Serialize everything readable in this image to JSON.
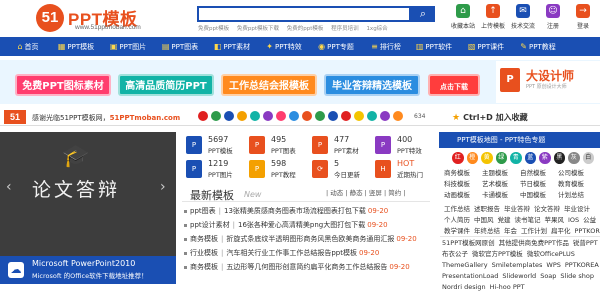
{
  "header": {
    "logo_badge": "51",
    "logo_title": "PPT模板",
    "logo_url": "www.51pptmoban.com",
    "search_placeholder": "",
    "hot_words": [
      "免费ppt模板",
      "免费ppt模板下载",
      "免费的ppt模板",
      "程序员培训",
      "1xg综合"
    ],
    "tools": [
      {
        "label": "收藏本站",
        "icon": "home-icon",
        "color": "#2e9b4a"
      },
      {
        "label": "上传模板",
        "icon": "upload-icon",
        "color": "#e8501e"
      },
      {
        "label": "技术交流",
        "icon": "chat-icon",
        "color": "#1a4fb3"
      },
      {
        "label": "注册",
        "icon": "user-icon",
        "color": "#8a3ac2"
      },
      {
        "label": "登录",
        "icon": "login-icon",
        "color": "#e8501e"
      }
    ]
  },
  "nav": [
    "首页",
    "PPT模板",
    "PPT图片",
    "PPT图表",
    "PPT素材",
    "PPT特效",
    "PPT专题",
    "排行榜",
    "PPT软件",
    "PPT课件",
    "PPT教程"
  ],
  "banner": {
    "pills": [
      {
        "label": "免费PPT图标素材",
        "color": "#ff3d6e"
      },
      {
        "label": "高清品质简历PPT",
        "color": "#12b3a6"
      },
      {
        "label": "工作总结会报模板",
        "color": "#ff8a1e"
      },
      {
        "label": "毕业答辩精选模板",
        "color": "#2b8de0"
      }
    ],
    "click_label": "点击下载",
    "ad_title": "大设计师",
    "ad_sub": "PPT 原创设计大师"
  },
  "welcome": {
    "badge": "51",
    "text_prefix": "感谢光临51PPT模板网，",
    "site": "51PPTmoban.com",
    "share_count": "634",
    "ctrl_d": "Ctrl+D 加入收藏"
  },
  "hero": {
    "caption": "论文答辩",
    "footer_line1": "Microsoft PowerPoint2010",
    "footer_line2": "Microsoft 的Office软件下载地址推荐！",
    "below": "PPT教程"
  },
  "stats": [
    {
      "num": "5697",
      "label": "PPT模板",
      "icon": "P",
      "color": "#1a4fb3"
    },
    {
      "num": "495",
      "label": "PPT图表",
      "icon": "P",
      "color": "#e8501e"
    },
    {
      "num": "477",
      "label": "PPT素材",
      "icon": "P",
      "color": "#e8501e"
    },
    {
      "num": "400",
      "label": "PPT特效",
      "icon": "P",
      "color": "#8a3ac2"
    },
    {
      "num": "1219",
      "label": "PPT图片",
      "icon": "P",
      "color": "#1a4fb3"
    },
    {
      "num": "598",
      "label": "PPT教程",
      "icon": "P",
      "color": "#f4a000"
    },
    {
      "num": "5",
      "label": "今日更新",
      "icon": "⟳",
      "color": "#e8501e"
    },
    {
      "num": "HOT",
      "label": "近期热门",
      "icon": "H",
      "color": "#e8501e"
    }
  ],
  "latest": {
    "title": "最新模板",
    "new_tag": "New",
    "tabs": "| 动态 | 静态 | 竖屏 | 简约 |",
    "items": [
      {
        "cat": "ppt图表",
        "title": "13张精美质感商务图表市场流程图表打包下载",
        "date": "09-20"
      },
      {
        "cat": "ppt设计素材",
        "title": "16张各种爱心高清精美png大图打包下载",
        "date": "09-20"
      },
      {
        "cat": "商务模板",
        "title": "折旋式条底纹半透明图形商务风黑色欧美商务通用汇报",
        "date": "09-20"
      },
      {
        "cat": "行业模板",
        "title": "汽车相关行业工作事工作总结报告ppt模板",
        "date": "09-20"
      },
      {
        "cat": "商务模板",
        "title": "五边形等几何图形创意简约扁平化商务工作总结报告",
        "date": "09-20"
      }
    ]
  },
  "right_panel": {
    "title": "PPT模板地图 - PPT特色专题",
    "colors": [
      {
        "t": "红",
        "c": "#e02020"
      },
      {
        "t": "橙",
        "c": "#ff8a1e"
      },
      {
        "t": "黄",
        "c": "#f4c400"
      },
      {
        "t": "绿",
        "c": "#2e9b4a"
      },
      {
        "t": "青",
        "c": "#12b3a6"
      },
      {
        "t": "蓝",
        "c": "#1a4fb3"
      },
      {
        "t": "紫",
        "c": "#8a3ac2"
      },
      {
        "t": "黑",
        "c": "#222222"
      },
      {
        "t": "灰",
        "c": "#888888"
      },
      {
        "t": "白",
        "c": "#cccccc"
      }
    ],
    "rows": [
      [
        "商务模板",
        "主题模板",
        "自然模板",
        "公司模板"
      ],
      [
        "科技模板",
        "艺术模板",
        "节日模板",
        "教育模板"
      ],
      [
        "动画模板",
        "卡通模板",
        "中国模板",
        "计划总结"
      ]
    ],
    "rows2": [
      [
        "工作总结",
        "述职报告",
        "毕业答辩",
        "论文答辩",
        "毕业设计"
      ],
      [
        "个人简历",
        "中国风",
        "党建",
        "读书笔记",
        "苹果风",
        "IOS",
        "公益"
      ],
      [
        "教学课件",
        "年终总结",
        "年会",
        "工作计划",
        "扁平化",
        "PPTKOREA"
      ]
    ],
    "links": [
      [
        "51PPT模板网原创",
        "其他提供商免费PPT作品",
        "锐普PPT"
      ],
      [
        "布衣公子",
        "微软官方PPT模板",
        "微软OfficePLUS"
      ],
      [
        "ThemeGallery",
        "Smiletemplates",
        "WPS",
        "PPTKOREA"
      ],
      [
        "PresentationLoad",
        "Slideworld",
        "Soap",
        "Slide shop"
      ],
      [
        "Nordri design",
        "Hi-hoo PPT"
      ]
    ]
  }
}
